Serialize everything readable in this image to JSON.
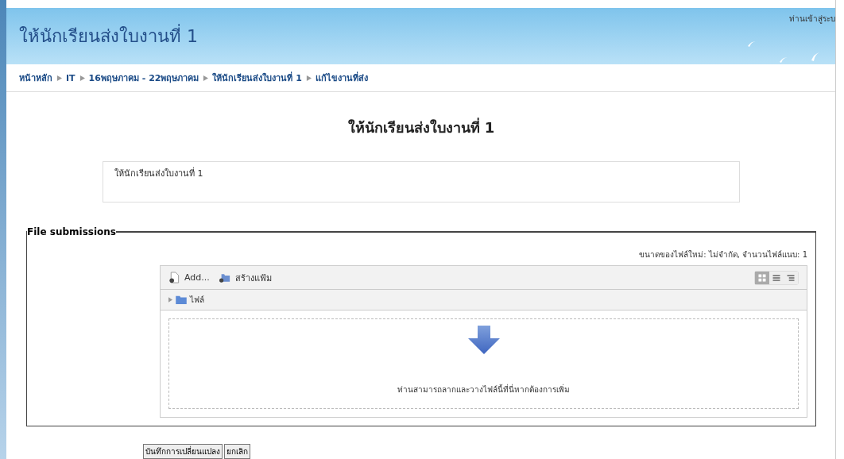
{
  "header": {
    "title": "ให้นักเรียนส่งใบงานที่ 1",
    "login_info": "ท่านเข้าสู่ระบ"
  },
  "breadcrumb": [
    "หน้าหลัก",
    "IT",
    "16พฤษภาคม - 22พฤษภาคม",
    "ให้นักเรียนส่งใบงานที่ 1",
    "แก้ไขงานที่ส่ง"
  ],
  "page_heading": "ให้นักเรียนส่งใบงานที่ 1",
  "intro": "ให้นักเรียนส่งใบงานที่ 1",
  "file_submissions": {
    "legend": "File submissions",
    "limits": "ขนาดของไฟล์ใหม่: ไม่จำกัด, จำนวนไฟล์แนบ: 1",
    "toolbar": [
      {
        "kind": "add",
        "label": "Add..."
      },
      {
        "kind": "folder",
        "label": "สร้างแฟ้ม"
      }
    ],
    "view_modes": [
      {
        "kind": "icons",
        "selected": true
      },
      {
        "kind": "list",
        "selected": false
      },
      {
        "kind": "tree",
        "selected": false
      }
    ],
    "path": "ไฟล์",
    "drop_hint": "ท่านสามารถลากและวางไฟล์นี้ที่นี่หากต้องการเพิ่ม"
  },
  "buttons": [
    "บันทึกการเปลี่ยนแปลง",
    "ยกเลิก"
  ]
}
